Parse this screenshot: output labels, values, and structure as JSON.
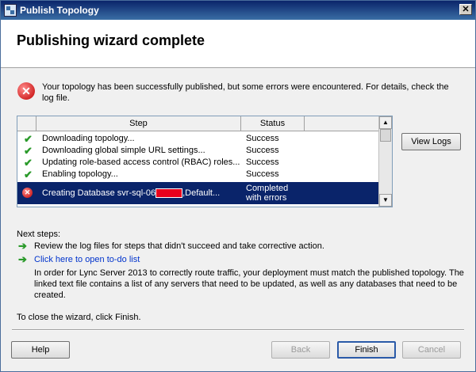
{
  "window": {
    "title": "Publish Topology",
    "close_glyph": "✕"
  },
  "header": {
    "title": "Publishing wizard complete"
  },
  "message": "Your topology has been successfully published, but some errors were encountered. For details, check the log file.",
  "table": {
    "columns": [
      "Step",
      "Status"
    ],
    "rows": [
      {
        "step": "Downloading topology...",
        "status": "Success",
        "icon": "checkmark-icon"
      },
      {
        "step": "Downloading global simple URL settings...",
        "status": "Success",
        "icon": "checkmark-icon"
      },
      {
        "step": "Updating role-based access control (RBAC) roles...",
        "status": "Success",
        "icon": "checkmark-icon"
      },
      {
        "step": "Enabling topology...",
        "status": "Success",
        "icon": "checkmark-icon"
      },
      {
        "step_prefix": "Creating Database svr-sql-06",
        "step_suffix": ",Default...",
        "status_line1": "Completed",
        "status_line2": "with errors",
        "icon": "error-icon"
      }
    ]
  },
  "buttons": {
    "view_logs": "View Logs",
    "help": "Help",
    "back": "Back",
    "finish": "Finish",
    "cancel": "Cancel"
  },
  "next_steps": {
    "heading": "Next steps:",
    "item1": "Review the log files for steps that didn't succeed and take corrective action.",
    "item2_link": "Click here to open to-do list",
    "item2_text": "In order for Lync Server 2013 to correctly route traffic, your deployment must match the published topology. The linked text file contains a list of any servers that need to be updated, as well as any databases that need to be created."
  },
  "close_instruction": "To close the wizard, click Finish.",
  "glyphs": {
    "check": "✔",
    "arrow": "➔",
    "error": "✕",
    "scroll_up": "▲",
    "scroll_down": "▼"
  },
  "colors": {
    "selection": "#0a246a",
    "link": "#0033cc",
    "success_green": "#2a9a2a",
    "error_red": "#c00000"
  }
}
